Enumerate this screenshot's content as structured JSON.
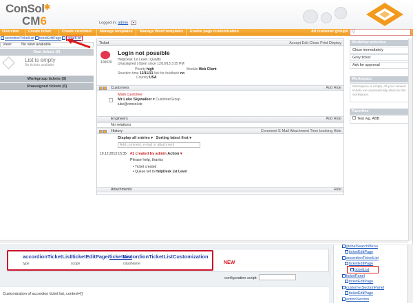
{
  "header": {
    "logo_line1": "ConSol",
    "logo_line2_prefix": "CM",
    "logo_line2_suffix": "6",
    "logged_in_label": "Logged in:",
    "user": "admin"
  },
  "nav": {
    "items": [
      "Overview",
      "Create ticket",
      "Create customer",
      "Manage templates",
      "Manage Word templates",
      "Enable page customization"
    ],
    "customer_groups": "All customer groups"
  },
  "search": {
    "value": "Q"
  },
  "left": {
    "crumbs": [
      "accordionTicketList",
      "ticketEditPage",
      "ticketList"
    ],
    "view_label": "View:",
    "view_value": "No view available",
    "own_tickets": "Own tickets (0)",
    "empty_title": "List is empty",
    "empty_sub": "No tickets available",
    "workgroup": "Workgroup tickets (0)",
    "unassigned": "Unassigned tickets (0)"
  },
  "ticket": {
    "section_title": "Ticket",
    "actions": "Accept  Edit  Close  Print  Display",
    "number": "100020",
    "title": "Login not possible",
    "meta1": "HelpDesk 1st Level | Qualify",
    "meta2": "Unassigned | Open since 12/10/13 3:35 PM",
    "priority_label": "Priority",
    "priority_value": "high",
    "module_label": "Module",
    "module_value": "Web Client",
    "reaction_label": "Reaction time",
    "reaction_value": "12/11/13",
    "feedback_label": "Ask for feedback",
    "feedback_value": "no",
    "country_label": "Country",
    "country_value": "USA"
  },
  "customers": {
    "title": "Customers",
    "actions": "Add  Hide",
    "main_label": "Main customer",
    "name": "Mr Luke Skywalker",
    "group": "CustomerGroup",
    "email": "luke@consol.de"
  },
  "engineers": {
    "title": "Engineers",
    "actions": "Add  Hide",
    "none": "No relations"
  },
  "history": {
    "title": "History",
    "actions": "Comment  E-Mail  Attachment  Time booking  Hide",
    "filter": "Display all entries",
    "sort": "Sorting latest first",
    "comment_placeholder": "Add comment, e-mail or attachment",
    "timestamp": "10.12.2013 15:35",
    "entry_title": "#1 created by admin",
    "entry_action": "Action",
    "entry_body": "Please help, thanks",
    "bullet1": "Ticket created",
    "bullet2_prefix": "Queue set to",
    "bullet2_value": "HelpDesk 1st Level"
  },
  "attachments": {
    "title": "Attachments",
    "actions": "Hide"
  },
  "workflow": {
    "title": "Workflow activities",
    "items": [
      "Close immediately",
      "Grey ticket",
      "Ask for approval"
    ]
  },
  "workspace": {
    "title": "Workspace",
    "note": "Workspace is empty. All your viewed tickets are automatically listed in this workspace."
  },
  "favorites": {
    "title": "Favorites",
    "item": "Test wg. ABB"
  },
  "config": {
    "type_value": "accordionTicketList",
    "type_label": "type",
    "scope_value_prefix": "/ticketEditPage/",
    "scope_value_suffix": "ticketList",
    "scope_label": "scope",
    "class_value": "AccordionTicketListCustomization",
    "class_label": "className",
    "new_label": "NEW",
    "script_label": "configuration script:",
    "description": "Customization of accordion ticket list, context=[]"
  },
  "tree": {
    "items": [
      "globalSearchMenu",
      "ticketEditPage",
      "accordionTicketList",
      "ticketEditPage",
      "ticketList",
      "ticketPanel",
      "ticketEditPage",
      "customerSectionPanel",
      "ticketEditPage",
      "actionSection"
    ]
  }
}
